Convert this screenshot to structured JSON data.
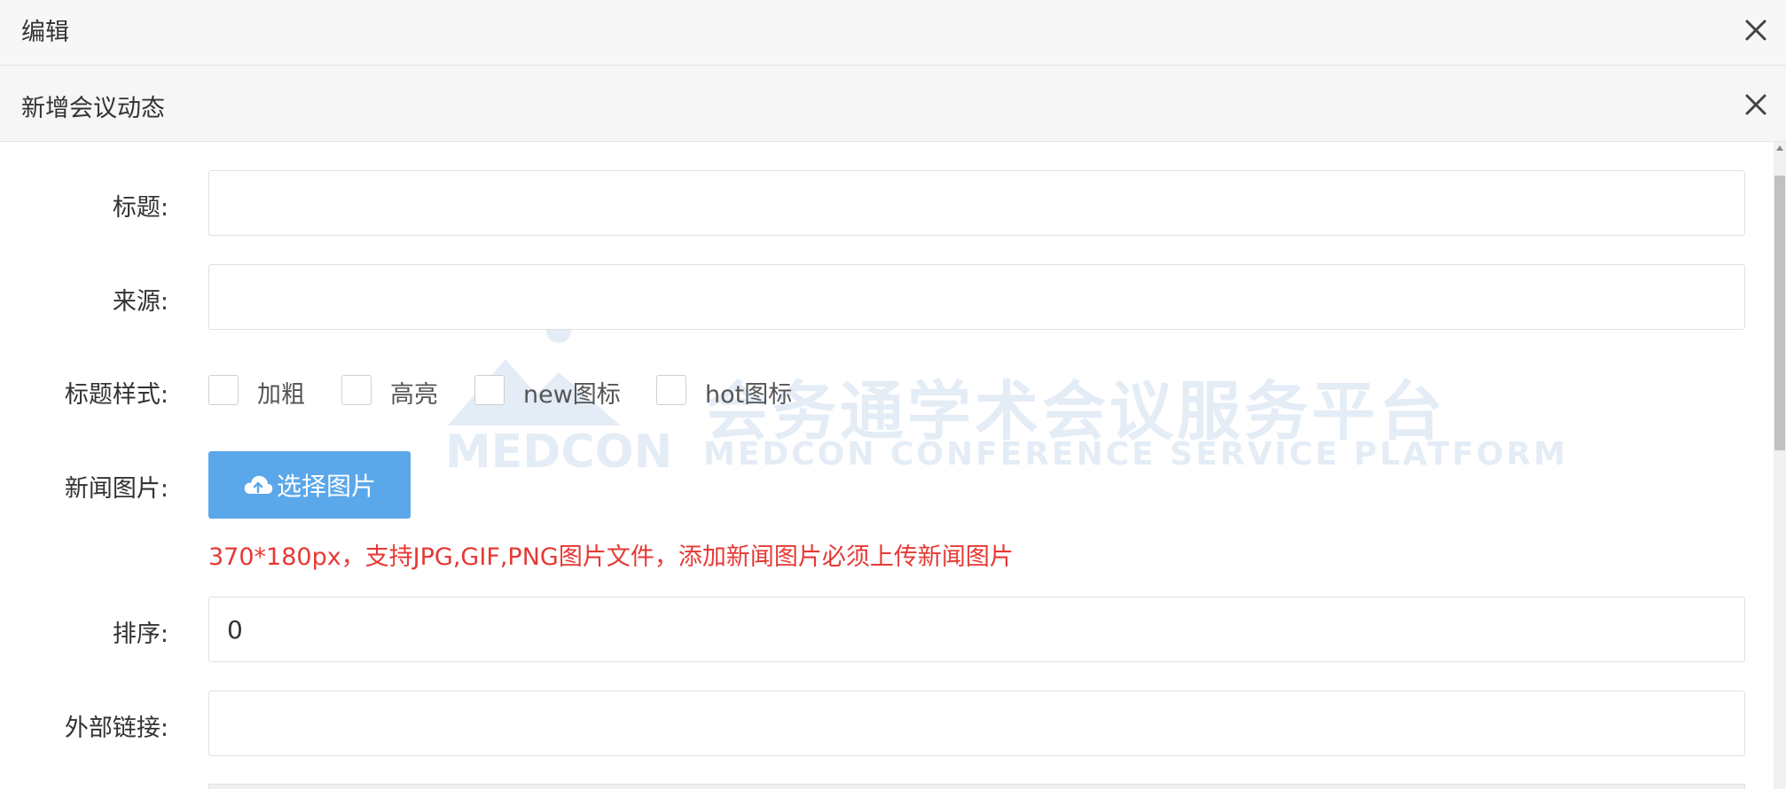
{
  "outer_dialog": {
    "title": "编辑"
  },
  "inner_dialog": {
    "title": "新增会议动态"
  },
  "form": {
    "title_label": "标题:",
    "title_value": "",
    "source_label": "来源:",
    "source_value": "",
    "style_label": "标题样式:",
    "style_options": [
      {
        "label": "加粗",
        "checked": false
      },
      {
        "label": "高亮",
        "checked": false
      },
      {
        "label": "new图标",
        "checked": false
      },
      {
        "label": "hot图标",
        "checked": false
      }
    ],
    "image_label": "新闻图片:",
    "image_button": "选择图片",
    "image_hint": "370*180px，支持JPG,GIF,PNG图片文件，添加新闻图片必须上传新闻图片",
    "order_label": "排序:",
    "order_value": "0",
    "link_label": "外部链接:",
    "link_value": ""
  },
  "watermark": {
    "cn": "会务通学术会议服务平台",
    "brand": "MEDCON",
    "en": "MEDCON CONFERENCE SERVICE PLATFORM"
  },
  "colors": {
    "primary_button": "#5aa7ea",
    "hint": "#e53935",
    "watermark": "#cfdef0"
  },
  "icons": {
    "close": "close-icon",
    "upload": "cloud-upload-icon"
  }
}
